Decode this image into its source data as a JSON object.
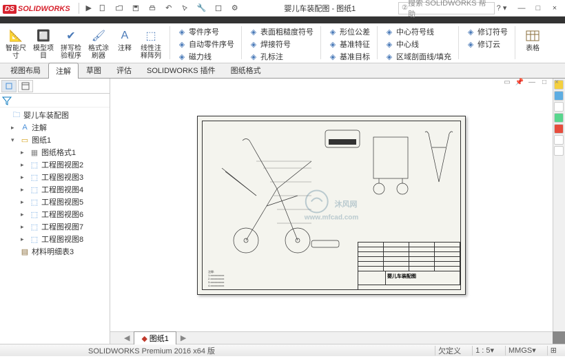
{
  "app": {
    "logo_prefix": "DS",
    "logo_text": "SOLIDWORKS"
  },
  "title": "婴儿车装配图 - 图纸1",
  "search_placeholder": "搜索 SOLIDWORKS 帮助",
  "ribbon": {
    "big_buttons": [
      {
        "label": "智能尺\n寸"
      },
      {
        "label": "模型项\n目"
      },
      {
        "label": "拼写检\n验程序"
      },
      {
        "label": "格式涂\n刷器"
      },
      {
        "label": "注释"
      },
      {
        "label": "线性注\n释阵列"
      }
    ],
    "col1": [
      {
        "label": "零件序号"
      },
      {
        "label": "自动零件序号"
      },
      {
        "label": "磁力线"
      }
    ],
    "col2": [
      {
        "label": "表面粗糙度符号"
      },
      {
        "label": "焊接符号"
      },
      {
        "label": "孔标注"
      }
    ],
    "col3": [
      {
        "label": "形位公差"
      },
      {
        "label": "基准特征"
      },
      {
        "label": "基准目标"
      }
    ],
    "col4": [
      {
        "label": "中心符号线"
      },
      {
        "label": "中心线"
      },
      {
        "label": "区域剖面线/填充"
      }
    ],
    "col5": [
      {
        "label": "修订符号"
      },
      {
        "label": "修订云"
      }
    ],
    "tables_label": "表格"
  },
  "tabs": [
    "视图布局",
    "注解",
    "草图",
    "评估",
    "SOLIDWORKS 插件",
    "图纸格式"
  ],
  "active_tab_index": 1,
  "tree": {
    "root": "婴儿车装配图",
    "annotations": "注解",
    "sheet": "图纸1",
    "items": [
      "图纸格式1",
      "工程图视图2",
      "工程图视图3",
      "工程图视图4",
      "工程图视图5",
      "工程图视图6",
      "工程图视图7",
      "工程图视图8"
    ],
    "bom": "材料明细表3"
  },
  "canvas_tab": "图纸1",
  "drawing": {
    "title": "婴儿车装配图",
    "watermark": "沐风网",
    "watermark_url": "www.mfcad.com"
  },
  "statusbar": {
    "version": "SOLIDWORKS Premium 2016 x64 版",
    "status": "欠定义",
    "scale": "1 : 5",
    "units": "MMGS"
  }
}
